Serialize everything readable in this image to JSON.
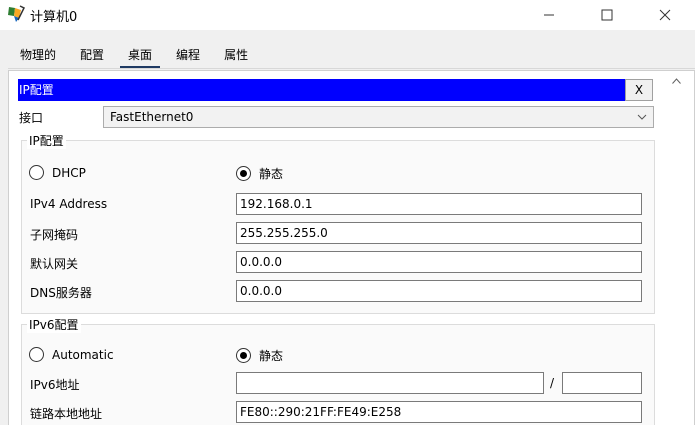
{
  "window": {
    "title": "计算机0",
    "icon": "packet-tracer-pc-icon"
  },
  "tabs": [
    {
      "label": "物理的",
      "active": false
    },
    {
      "label": "配置",
      "active": false
    },
    {
      "label": "桌面",
      "active": true
    },
    {
      "label": "编程",
      "active": false
    },
    {
      "label": "属性",
      "active": false
    }
  ],
  "ip_config": {
    "header": "IP配置",
    "close_label": "X",
    "interface_label": "接口",
    "interface_value": "FastEthernet0",
    "ipv4": {
      "legend": "IP配置",
      "dhcp_label": "DHCP",
      "static_label": "静态",
      "mode": "static",
      "address_label": "IPv4 Address",
      "address_value": "192.168.0.1",
      "mask_label": "子网掩码",
      "mask_value": "255.255.255.0",
      "gateway_label": "默认网关",
      "gateway_value": "0.0.0.0",
      "dns_label": "DNS服务器",
      "dns_value": "0.0.0.0"
    },
    "ipv6": {
      "legend": "IPv6配置",
      "auto_label": "Automatic",
      "static_label": "静态",
      "mode": "static",
      "address_label": "IPv6地址",
      "address_value": "",
      "prefix_separator": "/",
      "prefix_value": "",
      "link_local_label": "链路本地地址",
      "link_local_value": "FE80::290:21FF:FE49:E258"
    }
  },
  "colors": {
    "header_bg": "#0000ff",
    "tab_underline": "#1f3a63"
  }
}
